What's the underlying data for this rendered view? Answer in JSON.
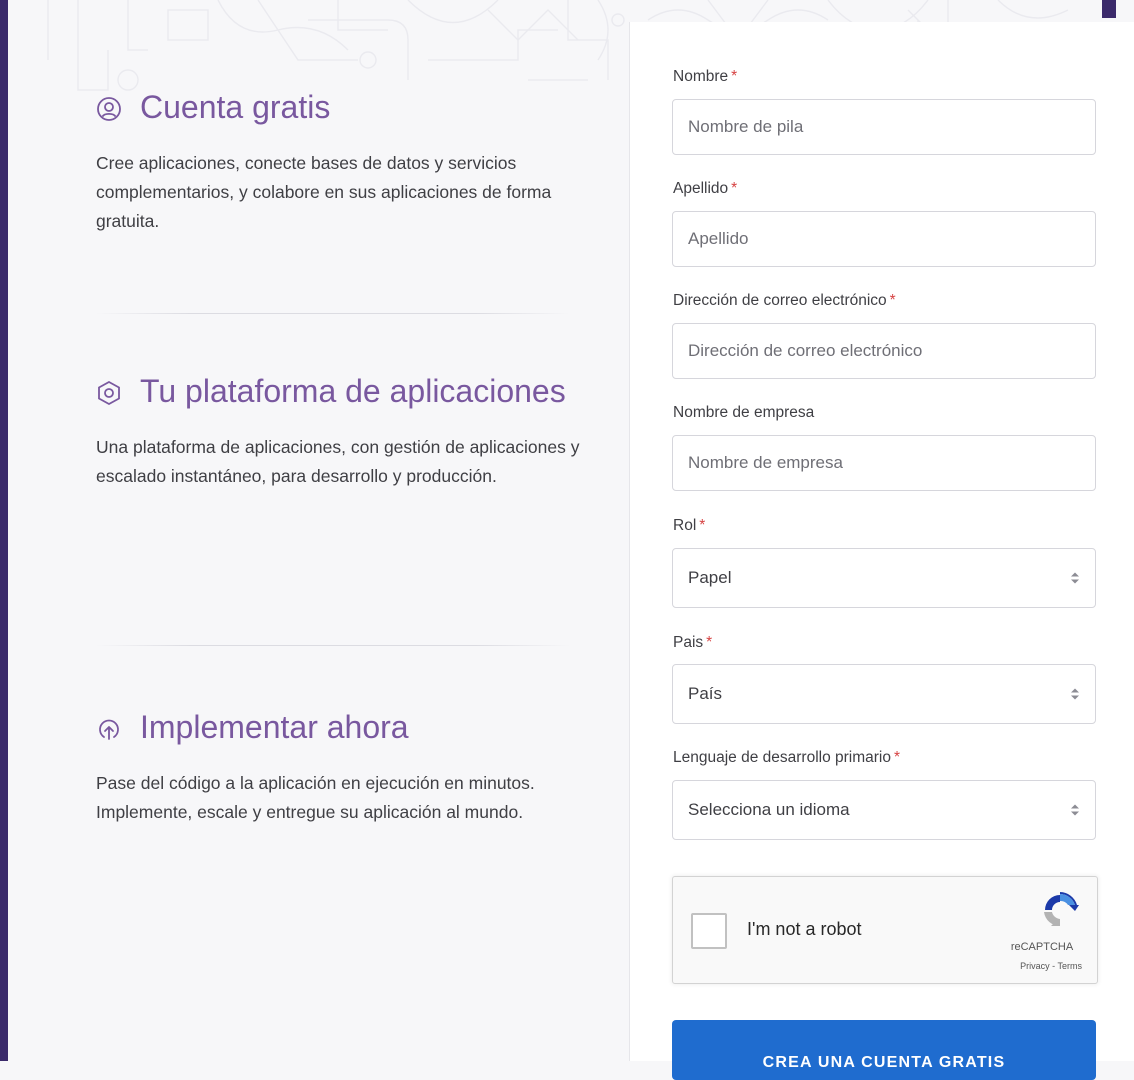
{
  "features": [
    {
      "icon": "user-circle-icon",
      "title": "Cuenta gratis",
      "description": "Cree aplicaciones, conecte bases de datos y servicios complementarios, y colabore en sus aplicaciones de forma gratuita."
    },
    {
      "icon": "hexagon-icon",
      "title": "Tu plataforma de aplicaciones",
      "description": "Una plataforma de aplicaciones, con gestión de aplicaciones y escalado instantáneo, para desarrollo y producción."
    },
    {
      "icon": "upload-cloud-icon",
      "title": "Implementar ahora",
      "description": "Pase del código a la aplicación en ejecución en minutos. Implemente, escale y entregue su aplicación al mundo."
    }
  ],
  "form": {
    "first_name": {
      "label": "Nombre",
      "required_mark": "*",
      "placeholder": "Nombre de pila",
      "value": ""
    },
    "last_name": {
      "label": "Apellido",
      "required_mark": "*",
      "placeholder": "Apellido",
      "value": ""
    },
    "email": {
      "label": "Dirección de correo electrónico",
      "required_mark": "*",
      "placeholder": "Dirección de correo electrónico",
      "value": ""
    },
    "company": {
      "label": "Nombre de empresa",
      "placeholder": "Nombre de empresa",
      "value": ""
    },
    "role": {
      "label": "Rol",
      "required_mark": "*",
      "selected": "Papel"
    },
    "country": {
      "label": "Pais",
      "required_mark": "*",
      "selected": "País"
    },
    "language": {
      "label": "Lenguaje de desarrollo primario",
      "required_mark": "*",
      "selected": "Selecciona un idioma"
    },
    "captcha": {
      "label": "I'm not a robot",
      "brand": "reCAPTCHA",
      "privacy": "Privacy",
      "separator": "-",
      "terms": "Terms",
      "checked": false
    },
    "submit_label": "CREA UNA CUENTA GRATIS"
  },
  "colors": {
    "accent_purple": "#79589f",
    "dark_purple": "#3b2a6b",
    "button_blue": "#1f6ccf",
    "required_red": "#d64242"
  }
}
